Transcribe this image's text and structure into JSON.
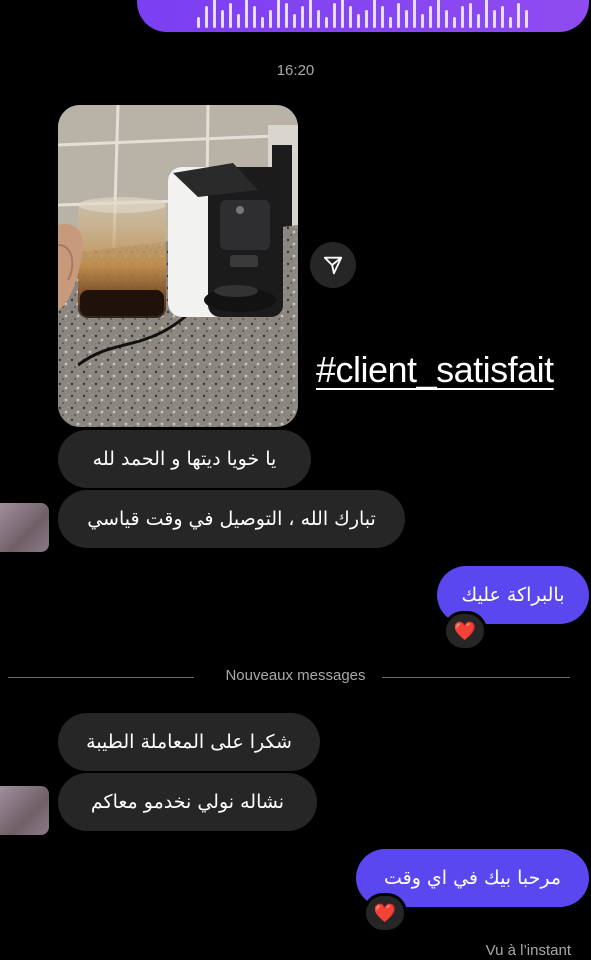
{
  "voice_message": {
    "waveform_levels": [
      0.3,
      0.6,
      0.9,
      0.5,
      0.7,
      0.4,
      0.8,
      0.6,
      0.3,
      0.5,
      0.9,
      0.7,
      0.4,
      0.6,
      0.8,
      0.5,
      0.3,
      0.7,
      0.9,
      0.6,
      0.4,
      0.5,
      0.8,
      0.6,
      0.3,
      0.7,
      0.5,
      0.9,
      0.4,
      0.6,
      0.8,
      0.5,
      0.3,
      0.6,
      0.7,
      0.4,
      0.9,
      0.5,
      0.6,
      0.3,
      0.7,
      0.5
    ]
  },
  "timestamp": "16:20",
  "story": {
    "hashtag": "#client_satisfait"
  },
  "messages": {
    "m1": "يا خويا ديتها و الحمد لله",
    "m2": "تبارك الله ، التوصيل في وقت قياسي",
    "m3": "بالبراكة عليك",
    "m4": "شكرا على المعاملة الطيبة",
    "m5": "نشاله نولي نخدمو معاكم",
    "m6": "مرحبا بيك في اي وقت"
  },
  "reactions": {
    "emoji": "❤️"
  },
  "divider": {
    "label": "Nouveaux messages"
  },
  "status": {
    "seen": "Vu à l’instant"
  },
  "colors": {
    "outgoing": "#5b47f0",
    "incoming": "#262626",
    "voice": "#7b3ff2"
  }
}
